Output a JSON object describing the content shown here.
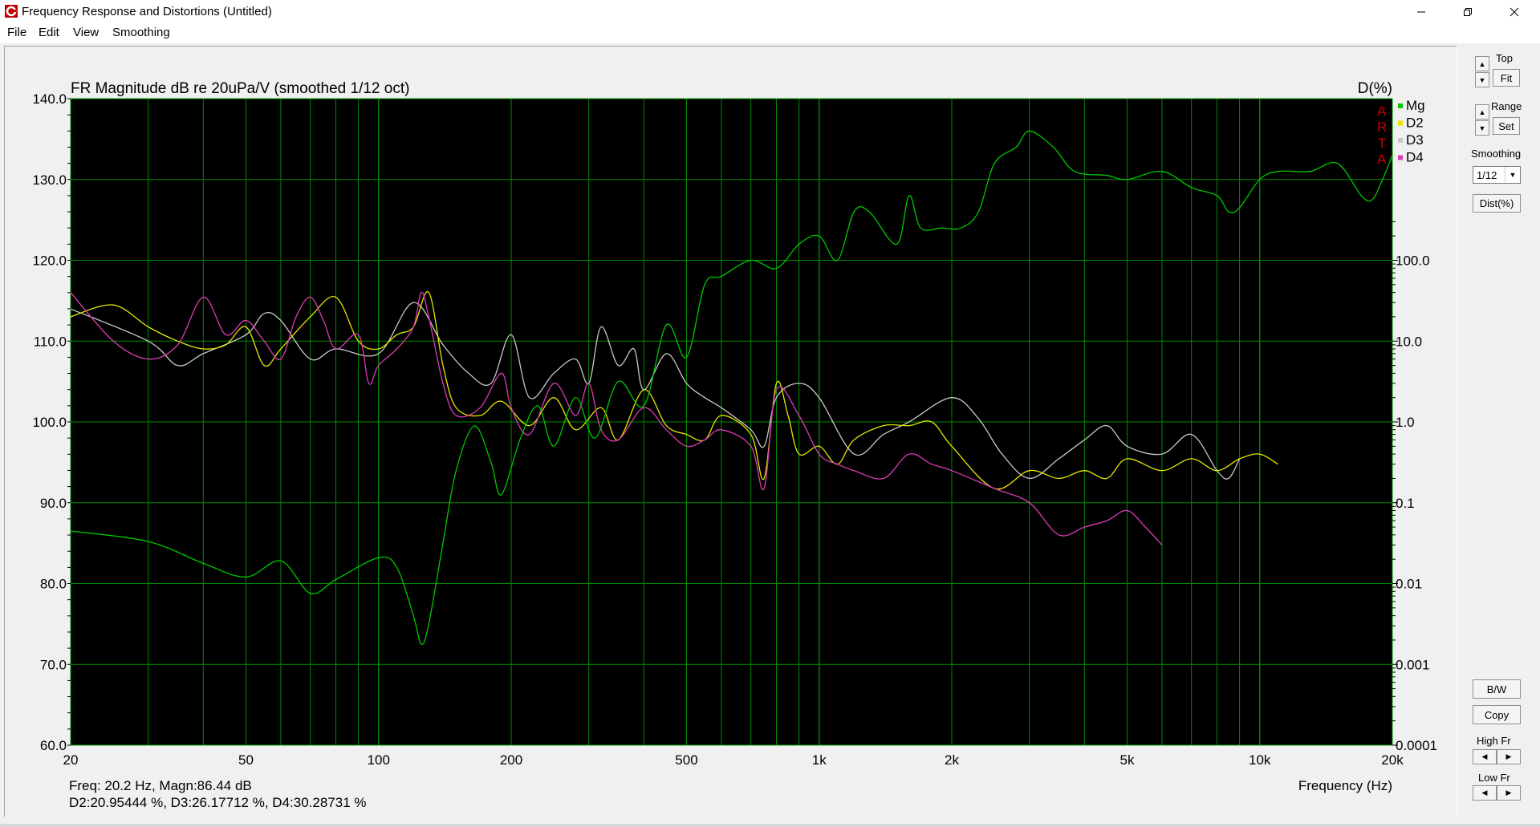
{
  "window": {
    "title": "Frequency Response and Distortions (Untitled)"
  },
  "menu": [
    "File",
    "Edit",
    "View",
    "Smoothing"
  ],
  "chart_data": {
    "type": "line",
    "title": "FR Magnitude dB re 20uPa/V (smoothed 1/12 oct)",
    "right_axis_title": "D(%)",
    "xlabel": "Frequency (Hz)",
    "xscale": "log",
    "xlim": [
      20,
      20000
    ],
    "ylim": [
      60,
      140
    ],
    "y2scale": "log",
    "y2lim": [
      0.0001,
      10000
    ],
    "x_tick_labels": [
      "20",
      "50",
      "100",
      "200",
      "500",
      "1k",
      "2k",
      "5k",
      "10k",
      "20k"
    ],
    "x_tick_values": [
      20,
      50,
      100,
      200,
      500,
      1000,
      2000,
      5000,
      10000,
      20000
    ],
    "y_tick_labels": [
      "140.0",
      "130.0",
      "120.0",
      "110.0",
      "100.0",
      "90.0",
      "80.0",
      "70.0",
      "60.0"
    ],
    "y2_tick_labels": [
      "100.0",
      "10.0",
      "1.0",
      "0.1",
      "0.01",
      "0.001",
      "0.0001"
    ],
    "y2_tick_values": [
      100,
      10,
      1,
      0.1,
      0.01,
      0.001,
      0.0001
    ],
    "grid": true,
    "watermark": "ARTA",
    "legend_position": "top-right",
    "series": [
      {
        "name": "Mg",
        "axis": "left",
        "color": "#00c800",
        "points": [
          [
            20,
            86.5
          ],
          [
            30,
            85.2
          ],
          [
            40,
            82.5
          ],
          [
            50,
            80.8
          ],
          [
            60,
            82.8
          ],
          [
            70,
            78.8
          ],
          [
            80,
            80.5
          ],
          [
            100,
            83.2
          ],
          [
            110,
            82
          ],
          [
            120,
            76
          ],
          [
            125,
            72.5
          ],
          [
            130,
            75
          ],
          [
            140,
            85
          ],
          [
            150,
            94
          ],
          [
            165,
            99.5
          ],
          [
            180,
            95
          ],
          [
            190,
            91
          ],
          [
            210,
            98
          ],
          [
            230,
            102
          ],
          [
            250,
            97
          ],
          [
            280,
            103
          ],
          [
            310,
            98
          ],
          [
            350,
            105
          ],
          [
            400,
            102
          ],
          [
            450,
            112
          ],
          [
            500,
            108
          ],
          [
            550,
            117
          ],
          [
            600,
            118
          ],
          [
            700,
            120
          ],
          [
            800,
            119
          ],
          [
            900,
            122
          ],
          [
            1000,
            123
          ],
          [
            1100,
            120
          ],
          [
            1200,
            126
          ],
          [
            1300,
            126
          ],
          [
            1500,
            122
          ],
          [
            1600,
            128
          ],
          [
            1700,
            124
          ],
          [
            1900,
            124
          ],
          [
            2100,
            124
          ],
          [
            2300,
            126
          ],
          [
            2500,
            132
          ],
          [
            2800,
            134
          ],
          [
            3000,
            136
          ],
          [
            3400,
            134
          ],
          [
            3800,
            131
          ],
          [
            4500,
            130.5
          ],
          [
            5000,
            130
          ],
          [
            6000,
            131
          ],
          [
            7000,
            129
          ],
          [
            8000,
            128
          ],
          [
            8500,
            126
          ],
          [
            9000,
            126.5
          ],
          [
            10000,
            130
          ],
          [
            11000,
            131
          ],
          [
            13000,
            131
          ],
          [
            15000,
            132
          ],
          [
            17000,
            128
          ],
          [
            18000,
            127.5
          ],
          [
            19000,
            130
          ],
          [
            20000,
            133
          ]
        ]
      },
      {
        "name": "D2",
        "axis": "right",
        "color": "#e6e600",
        "points": [
          [
            20,
            20
          ],
          [
            25,
            28
          ],
          [
            30,
            15
          ],
          [
            35,
            10
          ],
          [
            40,
            8
          ],
          [
            45,
            9
          ],
          [
            50,
            15
          ],
          [
            55,
            5
          ],
          [
            60,
            8
          ],
          [
            70,
            20
          ],
          [
            80,
            35
          ],
          [
            90,
            10
          ],
          [
            100,
            8
          ],
          [
            110,
            12
          ],
          [
            120,
            15
          ],
          [
            130,
            40
          ],
          [
            140,
            5
          ],
          [
            150,
            1.5
          ],
          [
            170,
            1.2
          ],
          [
            190,
            1.8
          ],
          [
            220,
            0.9
          ],
          [
            250,
            2
          ],
          [
            280,
            0.8
          ],
          [
            320,
            1.5
          ],
          [
            350,
            0.6
          ],
          [
            400,
            2.5
          ],
          [
            450,
            0.9
          ],
          [
            500,
            0.7
          ],
          [
            550,
            0.6
          ],
          [
            600,
            1.2
          ],
          [
            700,
            0.7
          ],
          [
            750,
            0.2
          ],
          [
            800,
            3
          ],
          [
            850,
            1.2
          ],
          [
            900,
            0.4
          ],
          [
            1000,
            0.5
          ],
          [
            1100,
            0.3
          ],
          [
            1200,
            0.6
          ],
          [
            1400,
            0.9
          ],
          [
            1600,
            0.9
          ],
          [
            1800,
            1
          ],
          [
            2000,
            0.5
          ],
          [
            2500,
            0.15
          ],
          [
            3000,
            0.25
          ],
          [
            3500,
            0.2
          ],
          [
            4000,
            0.25
          ],
          [
            4500,
            0.2
          ],
          [
            5000,
            0.35
          ],
          [
            6000,
            0.25
          ],
          [
            7000,
            0.35
          ],
          [
            8000,
            0.25
          ],
          [
            9000,
            0.35
          ],
          [
            10000,
            0.4
          ],
          [
            11000,
            0.3
          ]
        ]
      },
      {
        "name": "D3",
        "axis": "right",
        "color": "#c8c8c8",
        "points": [
          [
            20,
            25
          ],
          [
            30,
            10
          ],
          [
            35,
            5
          ],
          [
            40,
            7
          ],
          [
            50,
            12
          ],
          [
            55,
            22
          ],
          [
            60,
            18
          ],
          [
            70,
            6
          ],
          [
            80,
            8
          ],
          [
            100,
            7
          ],
          [
            120,
            30
          ],
          [
            140,
            9
          ],
          [
            160,
            4
          ],
          [
            180,
            3
          ],
          [
            200,
            12
          ],
          [
            220,
            2
          ],
          [
            250,
            4
          ],
          [
            280,
            6
          ],
          [
            300,
            3
          ],
          [
            320,
            15
          ],
          [
            350,
            5
          ],
          [
            380,
            8
          ],
          [
            400,
            2.5
          ],
          [
            450,
            7
          ],
          [
            500,
            3
          ],
          [
            550,
            2
          ],
          [
            600,
            1.5
          ],
          [
            700,
            0.8
          ],
          [
            750,
            0.5
          ],
          [
            800,
            2
          ],
          [
            900,
            3
          ],
          [
            1000,
            2
          ],
          [
            1200,
            0.4
          ],
          [
            1400,
            0.7
          ],
          [
            1600,
            1
          ],
          [
            2000,
            2
          ],
          [
            2300,
            1.1
          ],
          [
            2600,
            0.4
          ],
          [
            3000,
            0.2
          ],
          [
            3500,
            0.35
          ],
          [
            4000,
            0.6
          ],
          [
            4500,
            0.9
          ],
          [
            5000,
            0.5
          ],
          [
            6000,
            0.4
          ],
          [
            7000,
            0.7
          ],
          [
            8000,
            0.25
          ],
          [
            8500,
            0.2
          ],
          [
            9000,
            0.35
          ]
        ]
      },
      {
        "name": "D4",
        "axis": "right",
        "color": "#dc3cb4",
        "points": [
          [
            20,
            40
          ],
          [
            25,
            10
          ],
          [
            30,
            6
          ],
          [
            35,
            9
          ],
          [
            40,
            35
          ],
          [
            45,
            12
          ],
          [
            50,
            18
          ],
          [
            55,
            10
          ],
          [
            60,
            6
          ],
          [
            65,
            20
          ],
          [
            70,
            35
          ],
          [
            75,
            18
          ],
          [
            80,
            8
          ],
          [
            90,
            12
          ],
          [
            95,
            3
          ],
          [
            100,
            5
          ],
          [
            110,
            8
          ],
          [
            120,
            15
          ],
          [
            125,
            40
          ],
          [
            130,
            20
          ],
          [
            140,
            3
          ],
          [
            150,
            1.2
          ],
          [
            170,
            1.5
          ],
          [
            190,
            4
          ],
          [
            200,
            1.5
          ],
          [
            220,
            0.7
          ],
          [
            250,
            3
          ],
          [
            280,
            1.2
          ],
          [
            300,
            3
          ],
          [
            320,
            0.8
          ],
          [
            350,
            0.6
          ],
          [
            400,
            1.5
          ],
          [
            450,
            0.8
          ],
          [
            500,
            0.5
          ],
          [
            550,
            0.6
          ],
          [
            600,
            0.8
          ],
          [
            700,
            0.5
          ],
          [
            750,
            0.15
          ],
          [
            800,
            2.5
          ],
          [
            900,
            1.2
          ],
          [
            1000,
            0.4
          ],
          [
            1100,
            0.3
          ],
          [
            1200,
            0.25
          ],
          [
            1400,
            0.2
          ],
          [
            1600,
            0.4
          ],
          [
            1800,
            0.3
          ],
          [
            2000,
            0.25
          ],
          [
            2500,
            0.15
          ],
          [
            3000,
            0.1
          ],
          [
            3500,
            0.04
          ],
          [
            4000,
            0.05
          ],
          [
            4500,
            0.06
          ],
          [
            5000,
            0.08
          ],
          [
            5500,
            0.05
          ],
          [
            6000,
            0.03
          ]
        ]
      }
    ]
  },
  "readout": {
    "line1": "Freq: 20.2 Hz, Magn:86.44 dB",
    "line2": "D2:20.95444 %, D3:26.17712 %, D4:30.28731 %"
  },
  "panel": {
    "top_label": "Top",
    "fit_label": "Fit",
    "range_label": "Range",
    "set_label": "Set",
    "smoothing_label": "Smoothing",
    "smoothing_value": "1/12",
    "dist_label": "Dist(%)",
    "bw_label": "B/W",
    "copy_label": "Copy",
    "high_fr_label": "High Fr",
    "low_fr_label": "Low Fr"
  }
}
